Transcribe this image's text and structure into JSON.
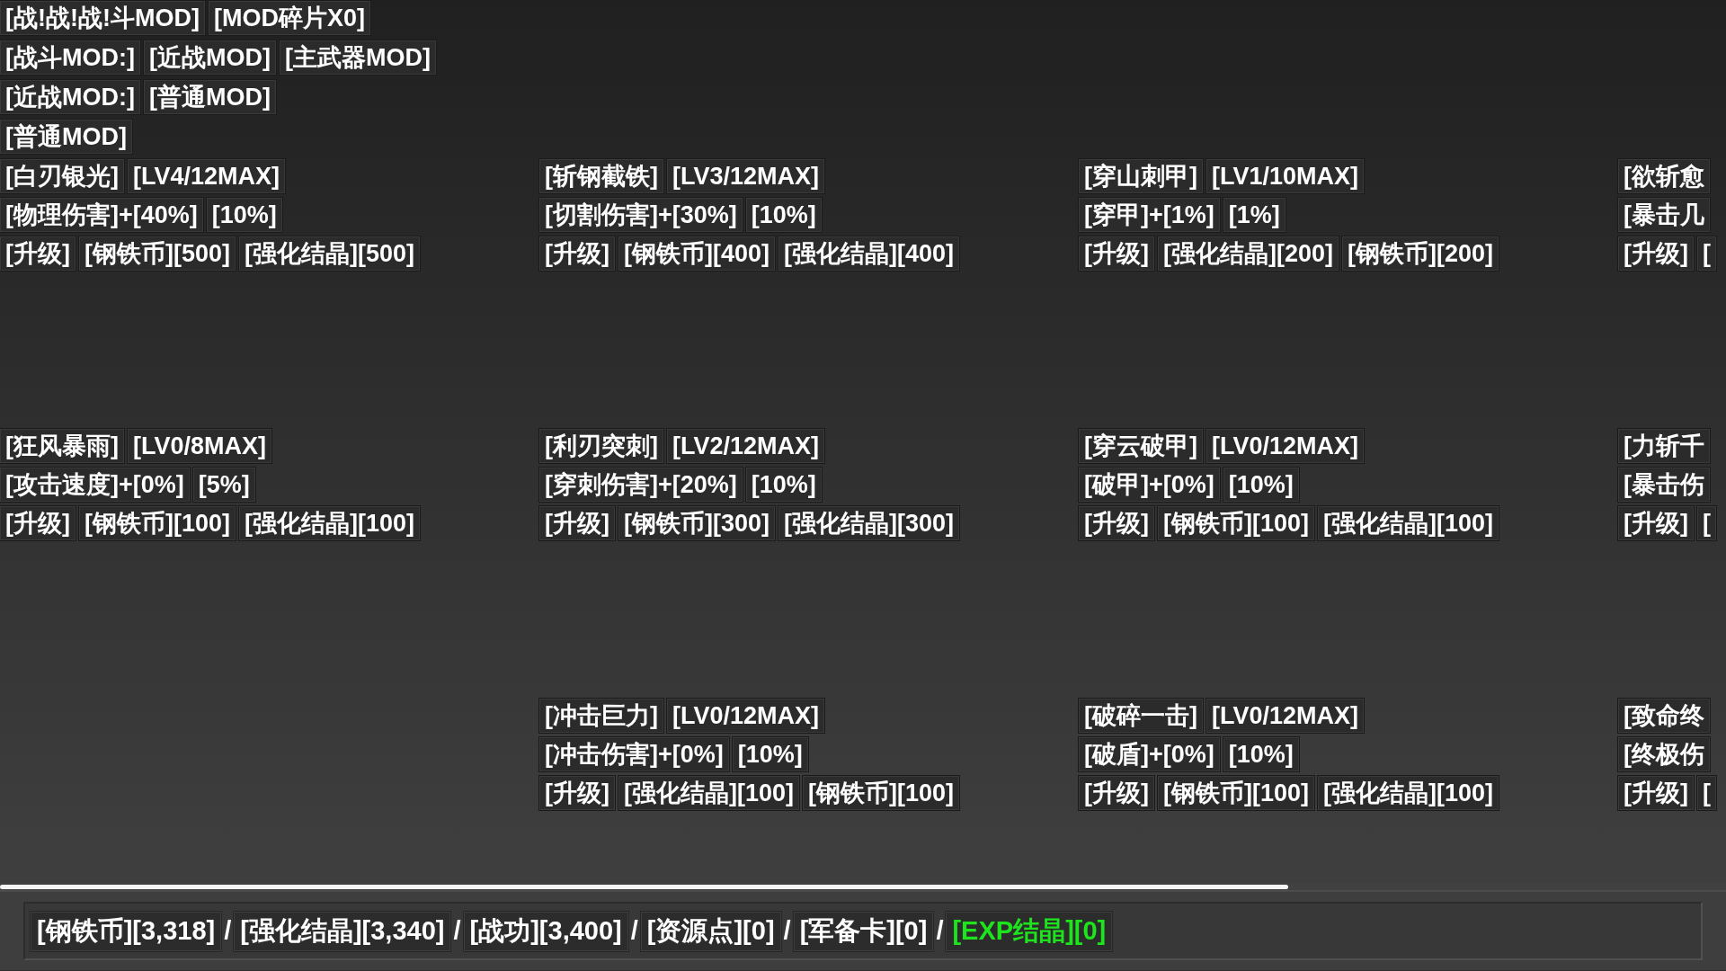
{
  "header": {
    "title": "[战!战!战!斗MOD]",
    "fragment_count": "[MOD碎片X0]"
  },
  "filter_rows": [
    {
      "label": "[战斗MOD:]",
      "options": [
        "[近战MOD]",
        "[主武器MOD]"
      ]
    },
    {
      "label": "[近战MOD:]",
      "options": [
        "[普通MOD]"
      ]
    }
  ],
  "section_title": "[普通MOD]",
  "mod_columns": [
    {
      "cards": [
        {
          "name": "[白刃银光]",
          "rank": "[LV4/12MAX]",
          "effect": "[物理伤害]+[40%]",
          "step": "[10%]",
          "upgrade": "[升级]",
          "costs": [
            "[钢铁币][500]",
            "[强化结晶][500]"
          ]
        },
        {
          "name": "[狂风暴雨]",
          "rank": "[LV0/8MAX]",
          "effect": "[攻击速度]+[0%]",
          "step": "[5%]",
          "upgrade": "[升级]",
          "costs": [
            "[钢铁币][100]",
            "[强化结晶][100]"
          ]
        }
      ]
    },
    {
      "cards": [
        {
          "name": "[斩钢截铁]",
          "rank": "[LV3/12MAX]",
          "effect": "[切割伤害]+[30%]",
          "step": "[10%]",
          "upgrade": "[升级]",
          "costs": [
            "[钢铁币][400]",
            "[强化结晶][400]"
          ]
        },
        {
          "name": "[利刃突刺]",
          "rank": "[LV2/12MAX]",
          "effect": "[穿刺伤害]+[20%]",
          "step": "[10%]",
          "upgrade": "[升级]",
          "costs": [
            "[钢铁币][300]",
            "[强化结晶][300]"
          ]
        },
        {
          "name": "[冲击巨力]",
          "rank": "[LV0/12MAX]",
          "effect": "[冲击伤害]+[0%]",
          "step": "[10%]",
          "upgrade": "[升级]",
          "costs": [
            "[强化结晶][100]",
            "[钢铁币][100]"
          ]
        }
      ]
    },
    {
      "cards": [
        {
          "name": "[穿山刺甲]",
          "rank": "[LV1/10MAX]",
          "effect": "[穿甲]+[1%]",
          "step": "[1%]",
          "upgrade": "[升级]",
          "costs": [
            "[强化结晶][200]",
            "[钢铁币][200]"
          ]
        },
        {
          "name": "[穿云破甲]",
          "rank": "[LV0/12MAX]",
          "effect": "[破甲]+[0%]",
          "step": "[10%]",
          "upgrade": "[升级]",
          "costs": [
            "[钢铁币][100]",
            "[强化结晶][100]"
          ]
        },
        {
          "name": "[破碎一击]",
          "rank": "[LV0/12MAX]",
          "effect": "[破盾]+[0%]",
          "step": "[10%]",
          "upgrade": "[升级]",
          "costs": [
            "[钢铁币][100]",
            "[强化结晶][100]"
          ]
        }
      ]
    },
    {
      "cards": [
        {
          "name": "[欲斩愈",
          "effect": "[暴击几",
          "upgrade": "[升级]",
          "costs": [
            "["
          ]
        },
        {
          "name": "[力斩千",
          "effect": "[暴击伤",
          "upgrade": "[升级]",
          "costs": [
            "["
          ]
        },
        {
          "name": "[致命终",
          "effect": "[终极伤",
          "upgrade": "[升级]",
          "costs": [
            "["
          ]
        }
      ]
    }
  ],
  "status_bar": {
    "resources": [
      {
        "kind": "value",
        "text": "[钢铁币][3,318]",
        "color": "#ffffff"
      },
      {
        "kind": "separator",
        "text": "/"
      },
      {
        "kind": "value",
        "text": "[强化结晶][3,340]",
        "color": "#ffffff"
      },
      {
        "kind": "separator",
        "text": "/"
      },
      {
        "kind": "value",
        "text": "[战功][3,400]",
        "color": "#ffffff"
      },
      {
        "kind": "separator",
        "text": "/"
      },
      {
        "kind": "value",
        "text": "[资源点][0]",
        "color": "#ffffff"
      },
      {
        "kind": "separator",
        "text": "/"
      },
      {
        "kind": "value",
        "text": "[军备卡][0]",
        "color": "#ffffff"
      },
      {
        "kind": "separator",
        "text": "/"
      },
      {
        "kind": "value",
        "text": "[EXP结晶][0]",
        "color": "#1ee41e"
      }
    ]
  }
}
